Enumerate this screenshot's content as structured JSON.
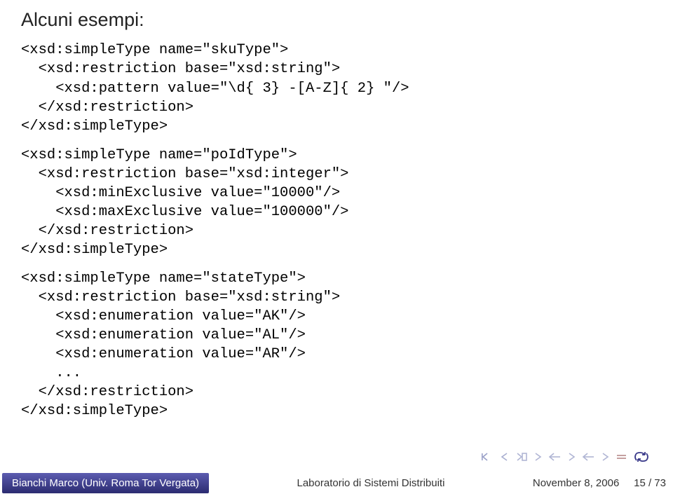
{
  "heading": "Alcuni esempi:",
  "code": {
    "block1": "<xsd:simpleType name=\"skuType\">\n  <xsd:restriction base=\"xsd:string\">\n    <xsd:pattern value=\"\\d{ 3} -[A-Z]{ 2} \"/>\n  </xsd:restriction>\n</xsd:simpleType>",
    "block2": "<xsd:simpleType name=\"poIdType\">\n  <xsd:restriction base=\"xsd:integer\">\n    <xsd:minExclusive value=\"10000\"/>\n    <xsd:maxExclusive value=\"100000\"/>\n  </xsd:restriction>\n</xsd:simpleType>",
    "block3": "<xsd:simpleType name=\"stateType\">\n  <xsd:restriction base=\"xsd:string\">\n    <xsd:enumeration value=\"AK\"/>\n    <xsd:enumeration value=\"AL\"/>\n    <xsd:enumeration value=\"AR\"/>\n    ...\n  </xsd:restriction>\n</xsd:simpleType>"
  },
  "nav": {
    "icons": {
      "first": "first-icon",
      "prev": "prev-icon",
      "next": "next-icon",
      "last": "last-icon",
      "back": "back-arrow-icon",
      "equal": "equal-icon",
      "loop": "loop-icon"
    },
    "colors": {
      "left": "#9aa0c8",
      "prev": "#a8aed0",
      "next": "#b0b5d4",
      "last": "#b0b5d4",
      "back": "#3a3a8a",
      "equal": "#c5a0a0",
      "loop": "#3a3a8a"
    }
  },
  "footer": {
    "left": "Bianchi Marco (Univ. Roma Tor Vergata)",
    "mid": "Laboratorio di Sistemi Distribuiti",
    "date": "November 8, 2006",
    "page": "15 / 73"
  }
}
